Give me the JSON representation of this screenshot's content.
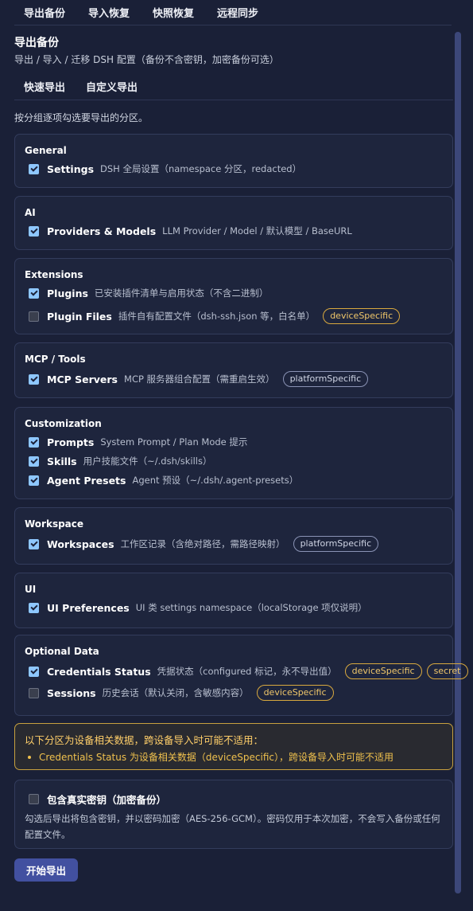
{
  "topnav": {
    "items": [
      "导出备份",
      "导入恢复",
      "快照恢复",
      "远程同步"
    ]
  },
  "page": {
    "title": "导出备份",
    "subtitle": "导出 / 导入 / 迁移 DSH 配置（备份不含密钥，加密备份可选）"
  },
  "subtabs": [
    "快速导出",
    "自定义导出"
  ],
  "hint": "按分组逐项勾选要导出的分区。",
  "groups": [
    {
      "title": "General",
      "items": [
        {
          "label": "Settings",
          "desc": "DSH 全局设置（namespace 分区，redacted）",
          "checked": true,
          "tags": []
        }
      ]
    },
    {
      "title": "AI",
      "items": [
        {
          "label": "Providers & Models",
          "desc": "LLM Provider / Model / 默认模型 / BaseURL",
          "checked": true,
          "tags": []
        }
      ]
    },
    {
      "title": "Extensions",
      "items": [
        {
          "label": "Plugins",
          "desc": "已安装插件清单与启用状态（不含二进制）",
          "checked": true,
          "tags": []
        },
        {
          "label": "Plugin Files",
          "desc": "插件自有配置文件（dsh-ssh.json 等，白名单）",
          "checked": false,
          "tags": [
            "deviceSpecific"
          ]
        }
      ]
    },
    {
      "title": "MCP / Tools",
      "items": [
        {
          "label": "MCP Servers",
          "desc": "MCP 服务器组合配置（需重启生效）",
          "checked": true,
          "tags": [
            "platformSpecific"
          ]
        }
      ]
    },
    {
      "title": "Customization",
      "items": [
        {
          "label": "Prompts",
          "desc": "System Prompt / Plan Mode 提示",
          "checked": true,
          "tags": []
        },
        {
          "label": "Skills",
          "desc": "用户技能文件（~/.dsh/skills）",
          "checked": true,
          "tags": []
        },
        {
          "label": "Agent Presets",
          "desc": "Agent 预设（~/.dsh/.agent-presets）",
          "checked": true,
          "tags": []
        }
      ]
    },
    {
      "title": "Workspace",
      "items": [
        {
          "label": "Workspaces",
          "desc": "工作区记录（含绝对路径，需路径映射）",
          "checked": true,
          "tags": [
            "platformSpecific"
          ]
        }
      ]
    },
    {
      "title": "UI",
      "items": [
        {
          "label": "UI Preferences",
          "desc": "UI 类 settings namespace（localStorage 项仅说明）",
          "checked": true,
          "tags": []
        }
      ]
    },
    {
      "title": "Optional Data",
      "items": [
        {
          "label": "Credentials Status",
          "desc": "凭据状态（configured 标记，永不导出值）",
          "checked": true,
          "tags": [
            "deviceSpecific",
            "secret"
          ]
        },
        {
          "label": "Sessions",
          "desc": "历史会话（默认关闭，含敏感内容）",
          "checked": false,
          "tags": [
            "deviceSpecific"
          ]
        }
      ]
    }
  ],
  "warning": {
    "title": "以下分区为设备相关数据，跨设备导入时可能不适用：",
    "items": [
      "Credentials Status 为设备相关数据（deviceSpecific），跨设备导入时可能不适用"
    ]
  },
  "secret": {
    "label": "包含真实密钥（加密备份）",
    "checked": false,
    "desc": "勾选后导出将包含密钥，并以密码加密（AES-256-GCM）。密码仅用于本次加密，不会写入备份或任何配置文件。"
  },
  "start_button": "开始导出",
  "colors": {
    "background": "#1a2037",
    "accent": "#4250a0",
    "checkbox": "#8ec7ff",
    "warning": "#f0c14d"
  }
}
